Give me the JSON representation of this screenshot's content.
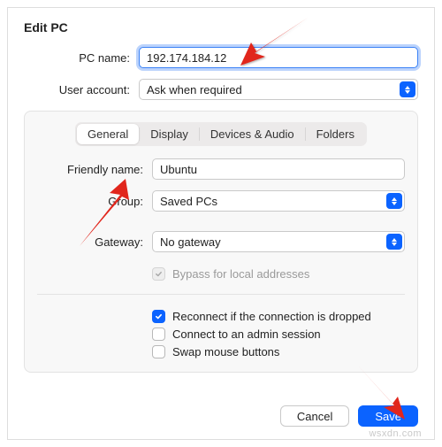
{
  "title": "Edit PC",
  "top": {
    "pc_name_label": "PC name:",
    "pc_name_value": "192.174.184.12",
    "user_account_label": "User account:",
    "user_account_value": "Ask when required"
  },
  "tabs": {
    "general": "General",
    "display": "Display",
    "devices": "Devices & Audio",
    "folders": "Folders"
  },
  "panel": {
    "friendly_name_label": "Friendly name:",
    "friendly_name_value": "Ubuntu",
    "group_label": "Group:",
    "group_value": "Saved PCs",
    "gateway_label": "Gateway:",
    "gateway_value": "No gateway",
    "bypass_label": "Bypass for local addresses",
    "reconnect_label": "Reconnect if the connection is dropped",
    "admin_label": "Connect to an admin session",
    "swap_label": "Swap mouse buttons"
  },
  "footer": {
    "cancel": "Cancel",
    "save": "Save"
  },
  "annotation": {
    "arrow_color": "#e1261c"
  },
  "watermark": "wsxdn.com"
}
